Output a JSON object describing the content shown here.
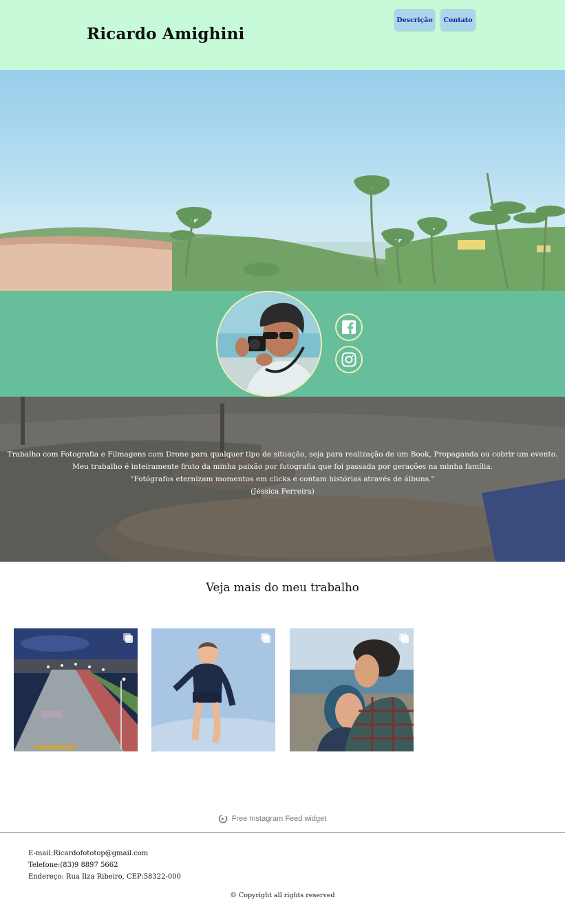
{
  "header": {
    "title": "Ricardo Amighini",
    "nav": [
      {
        "label": "Descrição"
      },
      {
        "label": "Contato"
      }
    ],
    "background": "#c6fad8",
    "nav_button_color": "#a9d6e9"
  },
  "profile": {
    "band_color": "#66be9a",
    "social": [
      {
        "icon": "facebook-icon"
      },
      {
        "icon": "instagram-icon"
      }
    ]
  },
  "about": {
    "paragraph": "Trabalho com Fotografia e Filmagens com Drone para qualquer tipo de situação, seja para realização de um Book, Propaganda ou cobrir um evento. Meu trabalho é inteiramente fruto da minha paixão por fotografia que foi passada por gerações na minha família.",
    "quote": "\"Fotógrafos eternizam momentos em clicks e contam histórias através de álbuns.\"",
    "quote_author": "(Jéssica Ferreira)"
  },
  "work": {
    "title": "Veja mais do meu trabalho",
    "widget_credit": "Free Instagram Feed widget"
  },
  "footer": {
    "email": "E-mail:Ricardofototop@gmail.com",
    "phone": "Telefone:(83)9 8897 5662",
    "address": "Endereço: Rua Ilza Ribeiro, CEP:58322-000",
    "copyright": "Copyright all rights reserved",
    "copyright_symbol": "©"
  }
}
